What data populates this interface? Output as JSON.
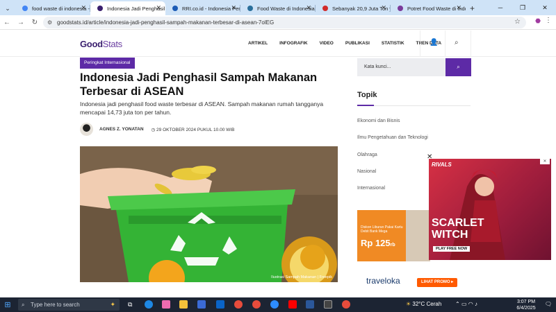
{
  "browser": {
    "tabs": [
      {
        "label": "food waste di indonesia - ",
        "favicon_color": "#4285f4"
      },
      {
        "label": "Indonesia Jadi Penghasil S",
        "favicon_color": "#3a1f6e"
      },
      {
        "label": "RRI.co.id - Indonesia Peng",
        "favicon_color": "#1c5bb5"
      },
      {
        "label": "Food Waste di Indonesia C",
        "favicon_color": "#2a6f9b"
      },
      {
        "label": "Sebanyak 20,9 Juta Ton ya",
        "favicon_color": "#d12b2b"
      },
      {
        "label": "Potret Food Waste di Indo",
        "favicon_color": "#7a3a9a"
      }
    ],
    "new_tab": "+",
    "url": "goodstats.id/article/indonesia-jadi-penghasil-sampah-makanan-terbesar-di-asean-7olEG"
  },
  "site": {
    "logo_good": "Good",
    "logo_stats": "Stats",
    "nav": [
      "ARTIKEL",
      "INFOGRAFIK",
      "VIDEO",
      "PUBLIKASI",
      "STATISTIK",
      "TREN DATA"
    ]
  },
  "article": {
    "category": "Peringkat Internasional",
    "title": "Indonesia Jadi Penghasil Sampah Makanan Terbesar di ASEAN",
    "lead": "Indonesia jadi penghasil food waste terbesar di ASEAN. Sampah makanan rumah tangganya mencapai 14,73 juta ton per tahun.",
    "author": "AGNES Z. YONATAN",
    "date": "29 OKTOBER 2024 PUKUL 10.00 WIB",
    "image_caption": "Ilustrasi Sampah Makanan | Freepik"
  },
  "sidebar": {
    "search_placeholder": "Kata kunci...",
    "topik_title": "Topik",
    "topik_items": [
      "Ekonomi dan Bisnis",
      "Ilmu Pengetahuan dan Teknologi",
      "Olahraga",
      "Nasional",
      "Internasional"
    ]
  },
  "ads": {
    "bank_text_1": "Diskon Liburan Pakai",
    "bank_text_2": "Kartu Debit Bank Mega",
    "bank_amount": "Rp 125",
    "bank_amount_suffix": "rb",
    "scarlet_brand": "RIVALS",
    "scarlet_title_1": "SCARLET",
    "scarlet_title_2": "WITCH",
    "scarlet_cta": "PLAY FREE NOW",
    "traveloka": "traveloka",
    "traveloka_cta": "LIHAT PROMO ▸",
    "close": "✕"
  },
  "taskbar": {
    "search_placeholder": "Type here to search",
    "temperature": "32°C",
    "weather": "Cerah",
    "time": "3:07 PM",
    "date": "6/4/2025"
  }
}
